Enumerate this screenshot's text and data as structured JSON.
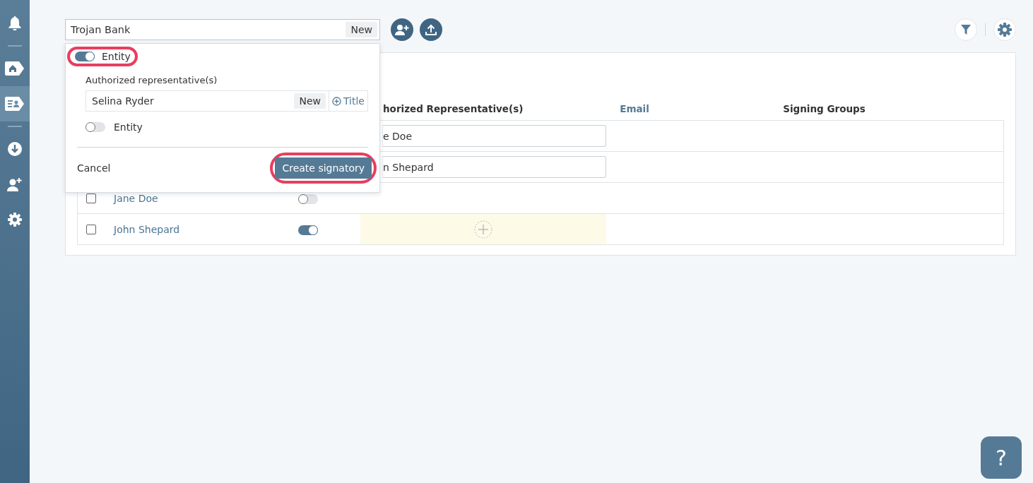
{
  "sidebar": {
    "items": [
      {
        "kind": "bell",
        "selected": false
      },
      {
        "kind": "divider"
      },
      {
        "kind": "home",
        "selected": false
      },
      {
        "kind": "contacts",
        "selected": true
      },
      {
        "kind": "divider"
      },
      {
        "kind": "download",
        "selected": false
      },
      {
        "kind": "add-user",
        "selected": false
      },
      {
        "kind": "gear",
        "selected": false
      }
    ]
  },
  "search_field": {
    "value": "Trojan Bank",
    "new_button": "New"
  },
  "popup": {
    "entity_toggle": {
      "label": "Entity",
      "on": true,
      "highlighted": true
    },
    "rep_label": "Authorized representative(s)",
    "rep_field": {
      "value": "Selina Ryder",
      "new_button": "New",
      "title_button": "Title"
    },
    "rep_entity_toggle": {
      "label": "Entity",
      "on": false
    },
    "cancel": "Cancel",
    "create_button": {
      "label": "Create signatory",
      "highlighted": true
    }
  },
  "table": {
    "columns": [
      {
        "label": "horized Representative(s)",
        "sorted": false
      },
      {
        "label": "Email",
        "sorted": true
      },
      {
        "label": "Signing Groups",
        "sorted": false
      }
    ],
    "rows": [
      {
        "kind": "representative",
        "representative": "e Doe"
      },
      {
        "kind": "representative",
        "representative": "n Shepard"
      },
      {
        "kind": "signer",
        "checked": false,
        "name": "Jane Doe",
        "entity": false,
        "adding": false
      },
      {
        "kind": "signer",
        "checked": false,
        "name": "John Shepard",
        "entity": true,
        "adding": true
      }
    ]
  },
  "help_button": "?"
}
